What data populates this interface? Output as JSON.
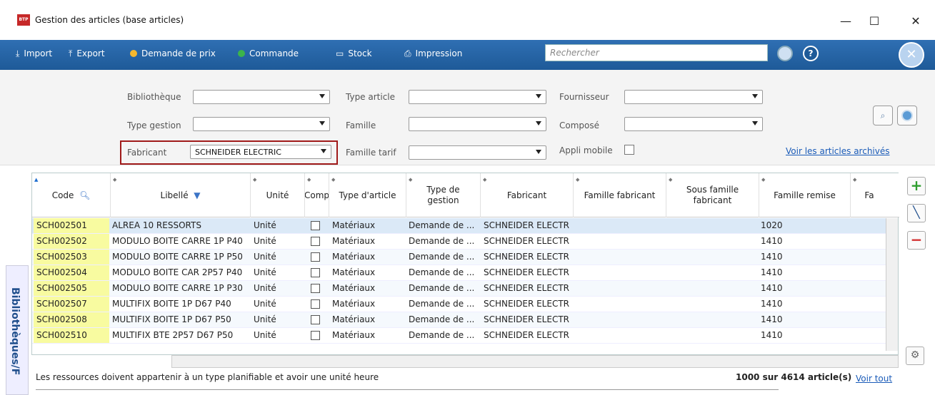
{
  "window": {
    "title": "Gestion des articles (base articles)",
    "app_badge": "BTP"
  },
  "toolbar": {
    "import": "Import",
    "export": "Export",
    "demande_prix": "Demande de prix",
    "commande": "Commande",
    "stock": "Stock",
    "impression": "Impression",
    "search_placeholder": "Rechercher"
  },
  "filters": {
    "bibliotheque": "Bibliothèque",
    "type_gestion": "Type gestion",
    "fabricant": "Fabricant",
    "fabricant_value": "SCHNEIDER ELECTRIC",
    "type_article": "Type article",
    "famille": "Famille",
    "famille_tarif": "Famille tarif",
    "fournisseur": "Fournisseur",
    "compose": "Composé",
    "appli_mobile": "Appli mobile",
    "archived_link": "Voir les articles archivés"
  },
  "grid": {
    "columns": [
      "Code",
      "Libellé",
      "Unité",
      "Comp",
      "Type d'article",
      "Type de gestion",
      "Fabricant",
      "Famille fabricant",
      "Sous famille fabricant",
      "Famille remise",
      "Fa"
    ],
    "rows": [
      {
        "code": "SCH002501",
        "libelle": "ALREA 10 RESSORTS",
        "unite": "Unité",
        "type": "Matériaux",
        "gestion": "Demande de ...",
        "fabricant": "SCHNEIDER ELECTR",
        "remise": "1020"
      },
      {
        "code": "SCH002502",
        "libelle": "MODULO BOITE CARRE 1P P40",
        "unite": "Unité",
        "type": "Matériaux",
        "gestion": "Demande de ...",
        "fabricant": "SCHNEIDER ELECTR",
        "remise": "1410"
      },
      {
        "code": "SCH002503",
        "libelle": "MODULO BOITE CARRE 1P P50",
        "unite": "Unité",
        "type": "Matériaux",
        "gestion": "Demande de ...",
        "fabricant": "SCHNEIDER ELECTR",
        "remise": "1410"
      },
      {
        "code": "SCH002504",
        "libelle": "MODULO BOITE CAR 2P57 P40",
        "unite": "Unité",
        "type": "Matériaux",
        "gestion": "Demande de ...",
        "fabricant": "SCHNEIDER ELECTR",
        "remise": "1410"
      },
      {
        "code": "SCH002505",
        "libelle": "MODULO BOITE CARRE 1P P30",
        "unite": "Unité",
        "type": "Matériaux",
        "gestion": "Demande de ...",
        "fabricant": "SCHNEIDER ELECTR",
        "remise": "1410"
      },
      {
        "code": "SCH002507",
        "libelle": "MULTIFIX BOITE 1P D67 P40",
        "unite": "Unité",
        "type": "Matériaux",
        "gestion": "Demande de ...",
        "fabricant": "SCHNEIDER ELECTR",
        "remise": "1410"
      },
      {
        "code": "SCH002508",
        "libelle": "MULTIFIX BOITE 1P D67 P50",
        "unite": "Unité",
        "type": "Matériaux",
        "gestion": "Demande de ...",
        "fabricant": "SCHNEIDER ELECTR",
        "remise": "1410"
      },
      {
        "code": "SCH002510",
        "libelle": "MULTIFIX BTE 2P57 D67 P50",
        "unite": "Unité",
        "type": "Matériaux",
        "gestion": "Demande de ...",
        "fabricant": "SCHNEIDER ELECTR",
        "remise": "1410"
      }
    ]
  },
  "side_tab": "Bibliothèques/F",
  "footer": {
    "message": "Les ressources doivent appartenir à un type planifiable et avoir une unité heure",
    "count": "1000 sur 4614 article(s)",
    "voir_tout": "Voir tout"
  },
  "colors": {
    "toolbar": "#2f6fb3",
    "highlight": "#f8fba0",
    "accent_red": "#a01a1a"
  }
}
